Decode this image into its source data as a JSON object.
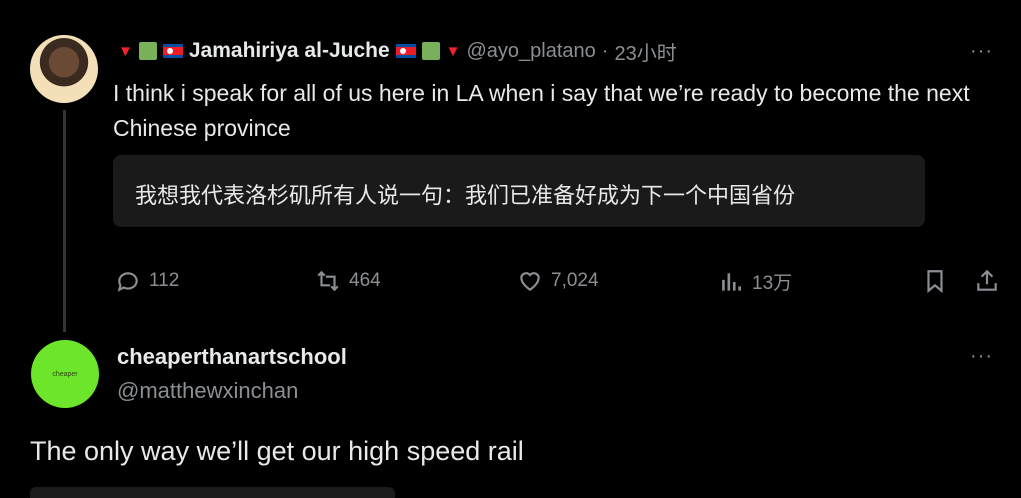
{
  "tweet": {
    "display_name": "Jamahiriya al-Juche",
    "handle": "@ayo_platano",
    "separator": "·",
    "time": "23小时",
    "text": "I think i speak for all of us here in LA when i say that we’re ready to become the next Chinese province",
    "translation": "我想我代表洛杉矶所有人说一句：我们已准备好成为下一个中国省份",
    "more_label": "···",
    "stats": {
      "replies": "112",
      "reposts": "464",
      "likes": "7,024",
      "views": "13万"
    }
  },
  "reply": {
    "display_name": "cheaperthanartschool",
    "handle": "@matthewxinchan",
    "avatar_text": "cheaper",
    "more_label": "···",
    "text": "The only way we’ll get our high speed rail"
  },
  "colors": {
    "background": "#000000",
    "text": "#e7e9ea",
    "muted": "#8b8f93",
    "avatar_green": "#6de52a"
  }
}
